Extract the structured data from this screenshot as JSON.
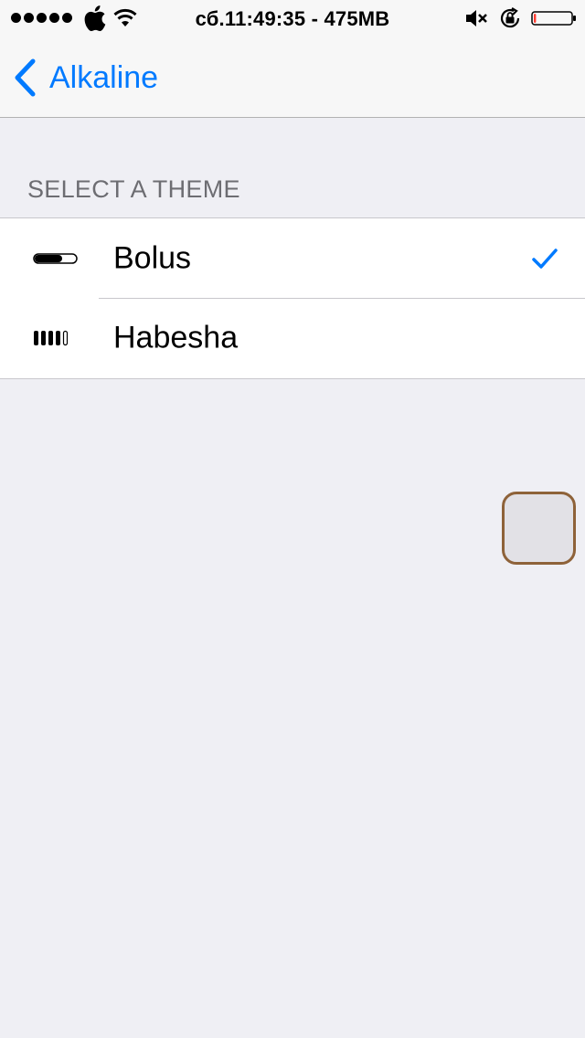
{
  "status_bar": {
    "signal_dots": 5,
    "time_memory": "сб.11:49:35 - 475MB",
    "icons": [
      "apple-logo-icon",
      "wifi-icon",
      "mute-icon",
      "rotation-lock-icon",
      "battery-icon"
    ],
    "battery_level": 0.06
  },
  "nav": {
    "back_label": "Alkaline"
  },
  "section": {
    "header": "SELECT A THEME"
  },
  "themes": [
    {
      "label": "Bolus",
      "icon": "bolus-battery-icon",
      "selected": true
    },
    {
      "label": "Habesha",
      "icon": "habesha-battery-icon",
      "selected": false
    }
  ],
  "colors": {
    "accent": "#007aff",
    "background": "#efeff4",
    "assistive_touch_border": "#8e6239"
  }
}
